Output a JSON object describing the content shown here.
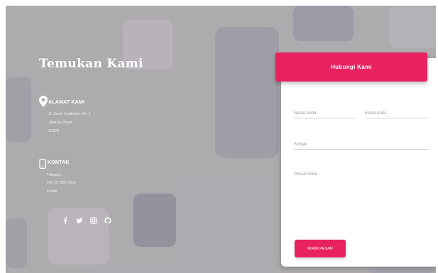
{
  "colors": {
    "accent": "#e8215f",
    "background": "#a9a6ab",
    "card": "#ffffff"
  },
  "left": {
    "title": "Temukan Kami",
    "address": {
      "icon": "map-pin-icon",
      "heading": "ALAMAT KAMI",
      "lines": [
        "Jl. Jend. Sudirman No. 1",
        "Jakarta Pusat",
        "10220"
      ]
    },
    "contact": {
      "icon": "phone-icon",
      "heading": "KONTAK",
      "lines": [
        "Telepon:",
        "+62 21 555 0101",
        "Email:"
      ]
    },
    "social_icons": [
      "facebook-icon",
      "twitter-icon",
      "instagram-icon",
      "github-icon"
    ]
  },
  "form": {
    "title": "Hubungi Kami",
    "name_placeholder": "Nama Anda",
    "email_placeholder": "Email Anda",
    "subject_placeholder": "Subjek",
    "message_placeholder": "Pesan Anda",
    "submit_label": "KIRIM PESAN"
  }
}
